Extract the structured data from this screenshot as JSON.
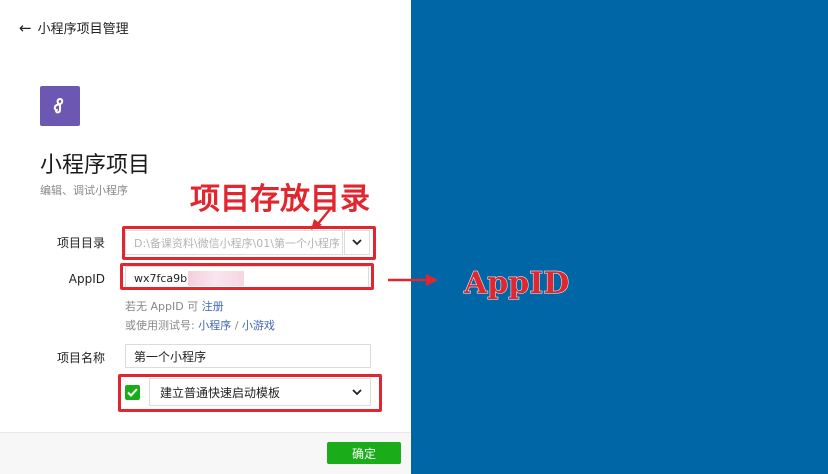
{
  "header": {
    "back_label": "小程序项目管理"
  },
  "project": {
    "title": "小程序项目",
    "subtitle": "编辑、调试小程序"
  },
  "form": {
    "dir_label": "项目目录",
    "dir_value": "D:\\备课资料\\微信小程序\\01\\第一个小程序",
    "appid_label": "AppID",
    "appid_value": "wx7fca9b",
    "hint1_prefix": "若无 AppID 可 ",
    "hint1_link": "注册",
    "hint2_prefix": "或使用测试号: ",
    "hint2_link_mini": "小程序",
    "hint2_sep": " / ",
    "hint2_link_game": "小游戏",
    "name_label": "项目名称",
    "name_value": "第一个小程序",
    "template_value": "建立普通快速启动模板",
    "template_checked": true
  },
  "footer": {
    "ok_label": "确定"
  },
  "annotations": {
    "dir_note": "项目存放目录",
    "appid_note": "AppID"
  },
  "colors": {
    "accent_green": "#1aad19",
    "annotation_red": "#e0262f",
    "background_blue": "#0066a6",
    "logo_purple": "#6c57b2"
  },
  "icons": {
    "back": "arrow-left-icon",
    "logo": "mini-program-icon",
    "dropdown": "chevron-down-icon",
    "check": "checkmark-icon"
  }
}
